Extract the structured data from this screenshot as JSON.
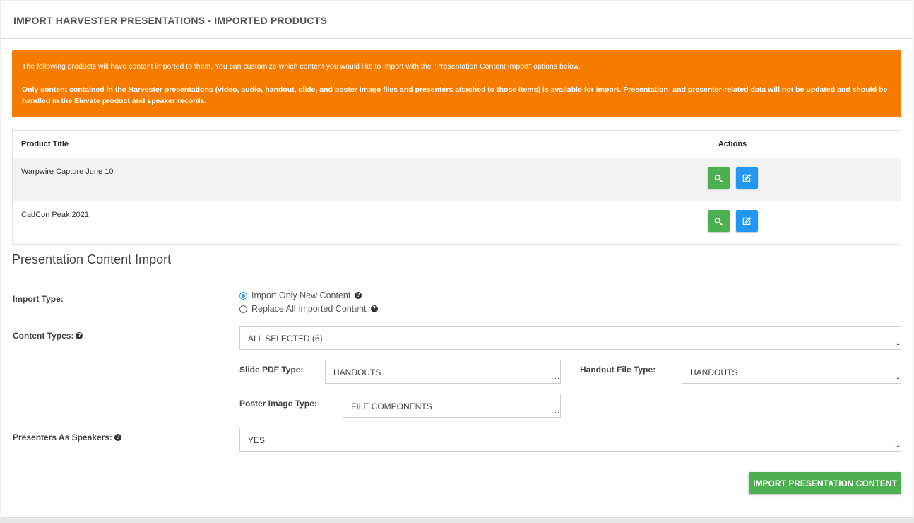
{
  "header": {
    "title": "IMPORT HARVESTER PRESENTATIONS - IMPORTED PRODUCTS"
  },
  "alert": {
    "line1": "The following products will have content imported to them. You can customize which content you would like to import with the \"Presentation Content Import\" options below.",
    "line2": "Only content contained in the Harvester presentations (video, audio, handout, slide, and poster image files and presenters attached to those items) is available for import. Presentation- and presenter-related data will not be updated and should be handled in the Elevate product and speaker records."
  },
  "table": {
    "columns": [
      "Product Title",
      "Actions"
    ],
    "rows": [
      {
        "title": "Warpwire Capture June 10"
      },
      {
        "title": "CadCon Peak 2021"
      }
    ],
    "view_icon": "search-icon",
    "edit_icon": "edit-icon"
  },
  "import_section": {
    "title": "Presentation Content Import",
    "import_type_label": "Import Type:",
    "import_type_options": [
      "Import Only New Content",
      "Replace All Imported Content"
    ],
    "import_type_selected": "Import Only New Content",
    "content_types_label": "Content Types:",
    "content_types_value": "ALL SELECTED (6)",
    "slide_pdf_label": "Slide PDF Type:",
    "slide_pdf_value": "HANDOUTS",
    "handout_file_label": "Handout File Type:",
    "handout_file_value": "HANDOUTS",
    "poster_image_label": "Poster Image Type:",
    "poster_image_value": "FILE COMPONENTS",
    "presenters_label": "Presenters As Speakers:",
    "presenters_value": "YES",
    "submit_label": "IMPORT PRESENTATION CONTENT",
    "dropdown_indicator": "..."
  },
  "colors": {
    "alert": "#f57c00",
    "green": "#4caf50",
    "blue": "#2196f3"
  }
}
